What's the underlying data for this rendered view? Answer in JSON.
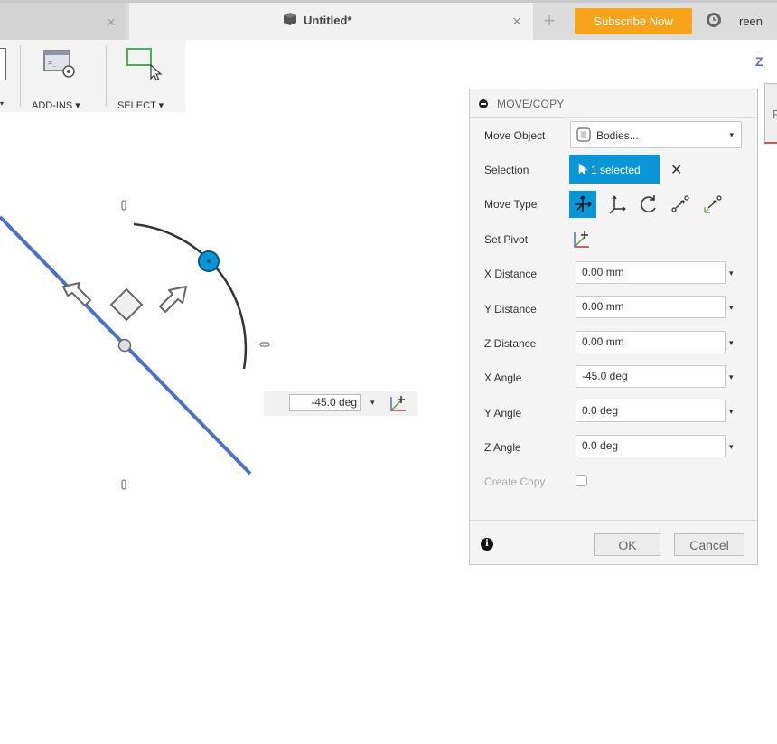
{
  "tabs": {
    "active_title": "Untitled*",
    "close_glyph": "×",
    "plus_glyph": "+",
    "subscribe_label": "Subscribe Now",
    "user_text": "reen"
  },
  "toolbar": {
    "addins_label": "ADD-INS ▾",
    "select_label": "SELECT ▾",
    "frag_caret": "▾"
  },
  "viewport": {
    "axis_label": "Z",
    "viewcube_text": "F",
    "angle_value": "-45.0 deg",
    "caret": "▾"
  },
  "dialog": {
    "title": "MOVE/COPY",
    "move_object": {
      "label": "Move Object",
      "value": "Bodies..."
    },
    "selection": {
      "label": "Selection",
      "button": "1 selected",
      "clear": "✕"
    },
    "move_type_label": "Move Type",
    "set_pivot_label": "Set Pivot",
    "fields": [
      {
        "label": "X Distance",
        "value": "0.00 mm"
      },
      {
        "label": "Y Distance",
        "value": "0.00 mm"
      },
      {
        "label": "Z Distance",
        "value": "0.00 mm"
      },
      {
        "label": "X Angle",
        "value": "-45.0 deg"
      },
      {
        "label": "Y Angle",
        "value": "0.0 deg"
      },
      {
        "label": "Z Angle",
        "value": "0.0 deg"
      }
    ],
    "create_copy_label": "Create Copy",
    "create_copy_checked": false,
    "ok_label": "OK",
    "cancel_label": "Cancel",
    "caret": "▾",
    "info_glyph": "i"
  },
  "colors": {
    "accent": "#0a96d6",
    "subscribe": "#f7a31c",
    "body_line": "#4a72c0"
  }
}
